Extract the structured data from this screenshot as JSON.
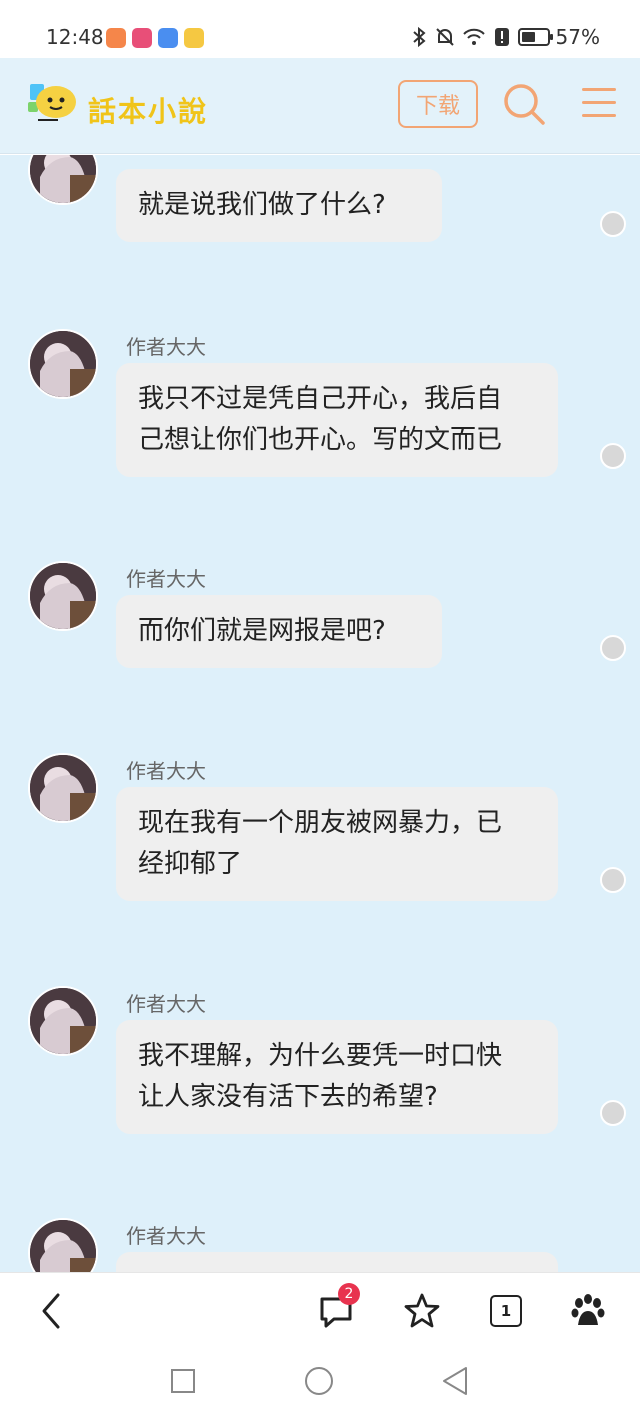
{
  "status": {
    "time": "12:48",
    "battery_percent": "57%",
    "battery_level": 0.57,
    "app_icon_colors": [
      "#f5864a",
      "#e84f78",
      "#4a8ef0",
      "#f5c842"
    ]
  },
  "header": {
    "logo_text": "話本小說",
    "download_label": "下载",
    "accent_color": "#f2a574"
  },
  "messages": [
    {
      "author": "",
      "text_lines": [
        "就是说我们做了什么?"
      ]
    },
    {
      "author": "作者大大",
      "text_lines": [
        "我只不过是凭自己开心，我后自",
        "己想让你们也开心。写的文而已"
      ]
    },
    {
      "author": "作者大大",
      "text_lines": [
        "而你们就是网报是吧?"
      ]
    },
    {
      "author": "作者大大",
      "text_lines": [
        "现在我有一个朋友被网暴力，已",
        "经抑郁了"
      ]
    },
    {
      "author": "作者大大",
      "text_lines": [
        "我不理解，为什么要凭一时口快",
        "让人家没有活下去的希望?"
      ]
    },
    {
      "author": "作者大大",
      "text_lines": [
        ""
      ]
    }
  ],
  "browser_bar": {
    "comments_badge": "2",
    "tab_count": "1"
  }
}
